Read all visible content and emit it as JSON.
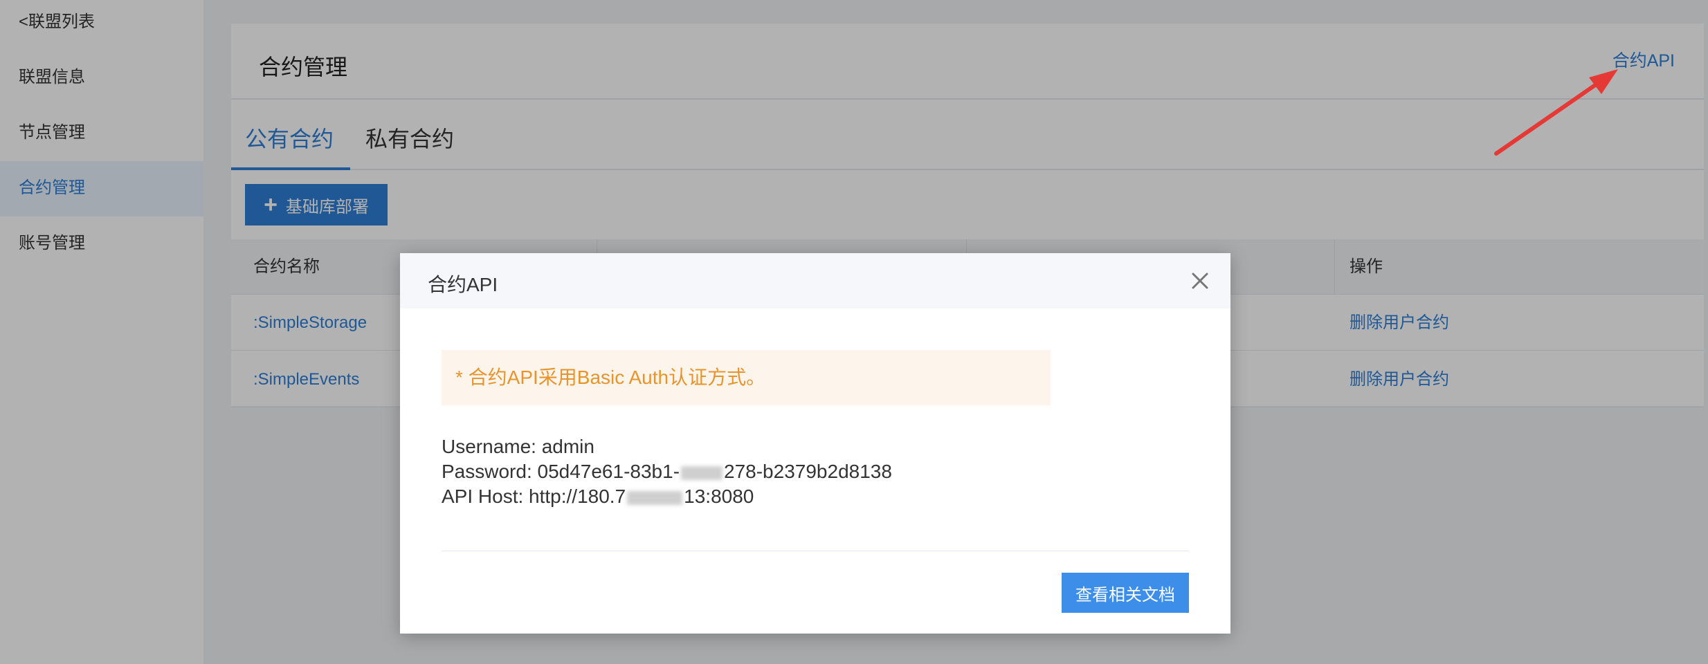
{
  "sidebar": {
    "back_label": "<联盟列表",
    "items": [
      {
        "label": "联盟信息",
        "active": false
      },
      {
        "label": "节点管理",
        "active": false
      },
      {
        "label": "合约管理",
        "active": true
      },
      {
        "label": "账号管理",
        "active": false
      }
    ]
  },
  "header": {
    "title": "合约管理",
    "api_link": "合约API"
  },
  "tabs": [
    {
      "label": "公有合约",
      "active": true
    },
    {
      "label": "私有合约",
      "active": false
    }
  ],
  "toolbar": {
    "deploy_label": "基础库部署"
  },
  "table": {
    "columns": [
      "合约名称",
      "",
      "",
      "操作"
    ],
    "rows": [
      {
        "name": ":SimpleStorage",
        "action": "删除用户合约"
      },
      {
        "name": ":SimpleEvents",
        "action": "删除用户合约"
      }
    ]
  },
  "modal": {
    "title": "合约API",
    "notice": "* 合约API采用Basic Auth认证方式。",
    "username_line": "Username: admin",
    "password_prefix": "Password: 05d47e61-83b1-",
    "password_suffix": "278-b2379b2d8138",
    "host_prefix": "API Host: http://180.7",
    "host_suffix": "13:8080",
    "doc_button": "查看相关文档"
  },
  "colors": {
    "accent": "#2e7fd6",
    "notice_text": "#e8942c",
    "notice_bg": "#fdf5ec",
    "annotation_arrow": "#e53935"
  }
}
